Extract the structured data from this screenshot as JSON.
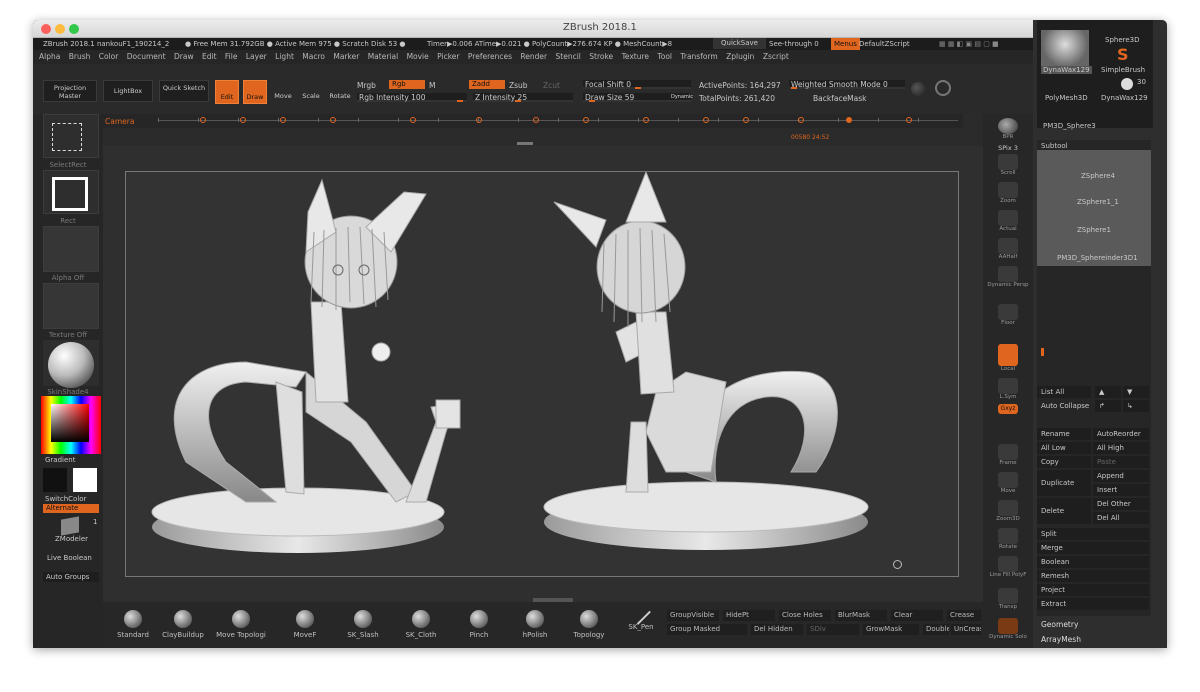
{
  "window": {
    "title": "ZBrush 2018.1"
  },
  "infobar": {
    "left": "ZBrush 2018.1 nankouF1_190214_2",
    "free_mem": "● Free Mem 31.792GB ● Active Mem 975 ● Scratch Disk 53 ●",
    "timer": "Timer▶0.006 ATime▶0.021 ● PolyCount▶276.674 KP ● MeshCount▶8",
    "quicksave": "QuickSave",
    "see_through": "See-through  0",
    "menus": "Menus",
    "default_zscript": "DefaultZScript"
  },
  "menu": [
    "Alpha",
    "Brush",
    "Color",
    "Document",
    "Draw",
    "Edit",
    "File",
    "Layer",
    "Light",
    "Macro",
    "Marker",
    "Material",
    "Movie",
    "Picker",
    "Preferences",
    "Render",
    "Stencil",
    "Stroke",
    "Texture",
    "Tool",
    "Transform",
    "Zplugin",
    "Zscript"
  ],
  "shelf": {
    "projection_master": "Projection Master",
    "lightbox": "LightBox",
    "quick_sketch": "Quick Sketch",
    "edit": "Edit",
    "draw": "Draw",
    "move": "Move",
    "scale": "Scale",
    "rotate": "Rotate",
    "mrgb": "Mrgb",
    "rgb": "Rgb",
    "m": "M",
    "zadd": "Zadd",
    "zsub": "Zsub",
    "zcut": "Zcut",
    "rgb_intensity": "Rgb Intensity 100",
    "z_intensity": "Z Intensity 25",
    "focal_shift": "Focal Shift 0",
    "draw_size": "Draw Size 59",
    "dynamic": "Dynamic",
    "active_points": "ActivePoints: 164,297",
    "total_points": "TotalPoints: 261,420",
    "weighted_smooth": "Weighted Smooth Mode 0",
    "backface_mask": "BackfaceMask"
  },
  "camera": {
    "label": "Camera",
    "frame": "00580 24:52"
  },
  "left_tray": {
    "select_rect": "SelectRect",
    "rect": "Rect",
    "alpha_off": "Alpha Off",
    "texture_off": "Texture Off",
    "skinshade": "SkinShade4",
    "gradient": "Gradient",
    "switchcolor": "SwitchColor",
    "alternate": "Alternate",
    "zmodeler": "ZModeler",
    "zmodeler_num": "1",
    "live_boolean": "Live Boolean",
    "auto_groups": "Auto Groups"
  },
  "right_tray": [
    "BPR",
    "SPix 3",
    "Scroll",
    "Zoom",
    "Actual",
    "AAHalf",
    "Dynamic Persp",
    "Floor",
    "Local",
    "L.Sym",
    "Gxyz",
    "Frame",
    "Move",
    "Zoom3D",
    "Rotate",
    "Line Fill PolyF",
    "Transp",
    "Dynamic Solo"
  ],
  "bottom_brushes": [
    "Standard",
    "ClayBuildup",
    "Move Topologi",
    "MoveF",
    "SK_Slash",
    "SK_Cloth",
    "Pinch",
    "hPolish",
    "Topology",
    "SK_Pen"
  ],
  "bottom_options": [
    "GroupVisible",
    "HidePt",
    "Close Holes",
    "BlurMask",
    "Clear",
    "Crease",
    "Group Masked",
    "Del Hidden",
    "GrowMask",
    "Double",
    "UnCrease",
    "SDiv"
  ],
  "tool_panel": {
    "top_items": [
      "DynaWax129",
      "Sphere3D",
      "SimpleBrush",
      "PolyMesh3D",
      "DynaWax129",
      "PM3D_Sphere3"
    ],
    "count": "30",
    "subtool_header": "Subtool",
    "subtools": [
      "ZSphere4",
      "ZSphere1_1",
      "ZSphere1",
      "PM3D_Sphereinder3D1"
    ],
    "list_all": "List All",
    "auto_collapse": "Auto Collapse",
    "buttons": [
      "Rename",
      "AutoReorder",
      "All Low",
      "All High",
      "Copy",
      "Paste",
      "Duplicate",
      "Append",
      "Insert",
      "Delete",
      "Del Other",
      "Del All",
      "Split",
      "Merge",
      "Boolean",
      "Remesh",
      "Project",
      "Extract"
    ],
    "geometry": "Geometry",
    "arraymesh": "ArrayMesh"
  },
  "colors": {
    "accent": "#e0661f",
    "bg": "#2b2b2b",
    "viewport": "#333333"
  }
}
